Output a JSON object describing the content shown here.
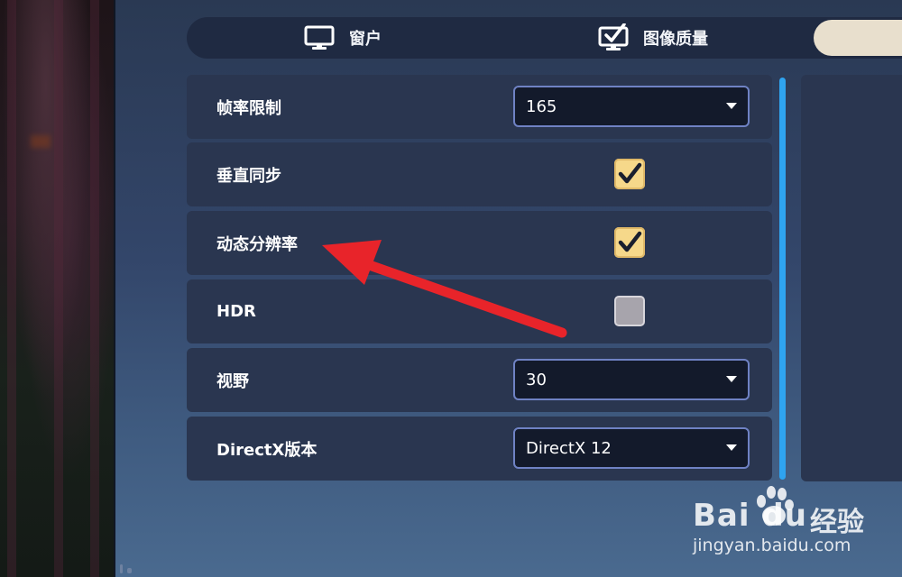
{
  "tabs": [
    {
      "label": "窗户",
      "icon": "monitor-icon"
    },
    {
      "label": "图像质量",
      "icon": "monitor-check-icon"
    }
  ],
  "settings": {
    "frame_limit": {
      "label": "帧率限制",
      "value": "165"
    },
    "vsync": {
      "label": "垂直同步",
      "checked": true
    },
    "dynamic_resolution": {
      "label": "动态分辨率",
      "checked": true
    },
    "hdr": {
      "label": "HDR",
      "checked": false
    },
    "fov": {
      "label": "视野",
      "value": "30"
    },
    "directx": {
      "label": "DirectX版本",
      "value": "DirectX 12"
    }
  },
  "watermark": {
    "logo": "Bai du",
    "brand": "经验",
    "url": "jingyan.baidu.com"
  },
  "colors": {
    "checkbox_checked": "#f6d88a",
    "checkbox_unchecked": "#a7a4ac",
    "dropdown_border": "#6f82c4",
    "scrollbar": "#2fa4f0",
    "annotation_arrow": "#e8242a"
  }
}
